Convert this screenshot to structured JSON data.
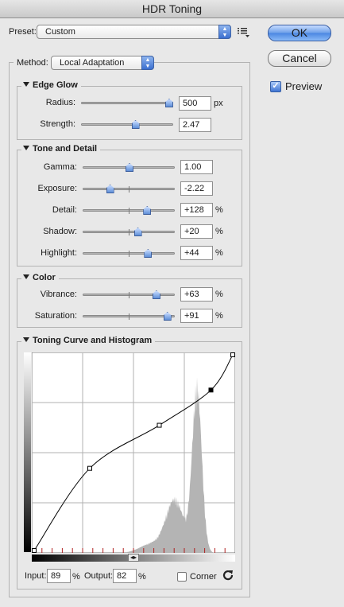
{
  "window": {
    "title": "HDR Toning"
  },
  "preset": {
    "label": "Preset:",
    "value": "Custom"
  },
  "buttons": {
    "ok": "OK",
    "cancel": "Cancel"
  },
  "preview": {
    "label": "Preview",
    "checked": true
  },
  "method": {
    "label": "Method:",
    "value": "Local Adaptation"
  },
  "edge_glow": {
    "title": "Edge Glow",
    "radius": {
      "label": "Radius:",
      "value": "500",
      "unit": "px",
      "level": 0.99
    },
    "strength": {
      "label": "Strength:",
      "value": "2.47",
      "level": 0.59
    }
  },
  "tone_detail": {
    "title": "Tone and Detail",
    "gamma": {
      "label": "Gamma:",
      "value": "1.00",
      "level": 0.5
    },
    "exposure": {
      "label": "Exposure:",
      "value": "-2.22",
      "level": 0.27
    },
    "detail": {
      "label": "Detail:",
      "value": "+128",
      "unit": "%",
      "level": 0.71
    },
    "shadow": {
      "label": "Shadow:",
      "value": "+20",
      "unit": "%",
      "level": 0.6
    },
    "highlight": {
      "label": "Highlight:",
      "value": "+44",
      "unit": "%",
      "level": 0.72
    }
  },
  "color": {
    "title": "Color",
    "vibrance": {
      "label": "Vibrance:",
      "value": "+63",
      "unit": "%",
      "level": 0.82
    },
    "saturation": {
      "label": "Saturation:",
      "value": "+91",
      "unit": "%",
      "level": 0.95
    }
  },
  "curve": {
    "title": "Toning Curve and Histogram",
    "points": [
      [
        0,
        0
      ],
      [
        28,
        42
      ],
      [
        63,
        64
      ],
      [
        89,
        82
      ],
      [
        100,
        100
      ]
    ],
    "input": {
      "label": "Input:",
      "value": "89",
      "unit": "%"
    },
    "output": {
      "label": "Output:",
      "value": "82",
      "unit": "%"
    },
    "corner": {
      "label": "Corner",
      "checked": false
    }
  },
  "colors": {
    "accent": "#4a86e2",
    "histogram": "#b4b4b4"
  }
}
